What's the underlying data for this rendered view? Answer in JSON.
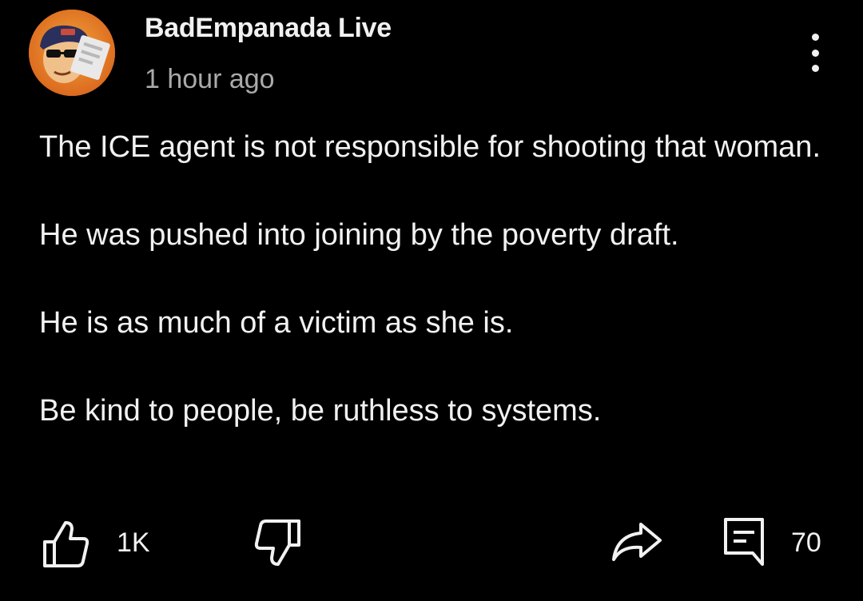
{
  "post": {
    "author": "BadEmpanada Live",
    "time": "1 hour ago",
    "paragraphs": [
      "The ICE agent is not responsible for shooting that woman.",
      "He was pushed into joining by the poverty draft.",
      "He is as much of a victim as she is.",
      "Be kind to people, be ruthless to systems."
    ]
  },
  "actions": {
    "like_count": "1K",
    "comment_count": "70"
  },
  "icons": {
    "menu": "more-vertical-icon",
    "like": "thumbs-up-icon",
    "dislike": "thumbs-down-icon",
    "share": "share-icon",
    "comment": "comment-icon"
  },
  "colors": {
    "background": "#000000",
    "text": "#f1f1f1",
    "secondary_text": "#aaaaaa",
    "avatar_bg": "#e88a2a"
  }
}
